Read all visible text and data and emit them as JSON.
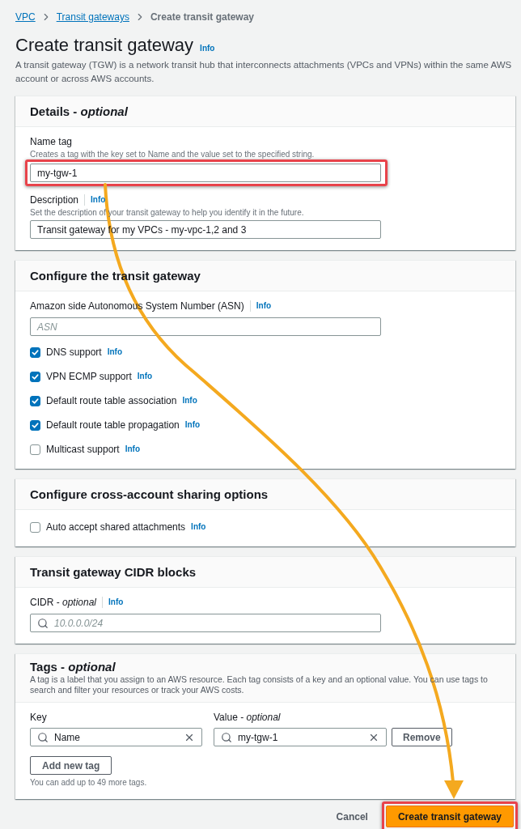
{
  "breadcrumbs": [
    {
      "label": "VPC",
      "kind": "link"
    },
    {
      "label": "Transit gateways",
      "kind": "link"
    },
    {
      "label": "Create transit gateway",
      "kind": "current"
    }
  ],
  "header": {
    "title": "Create transit gateway",
    "info": "Info",
    "description": "A transit gateway (TGW) is a network transit hub that interconnects attachments (VPCs and VPNs) within the same AWS account or across AWS accounts."
  },
  "sections": [
    {
      "title": "Details - *optional*",
      "items": [
        {
          "kind": "input",
          "label": "Name tag",
          "hint": "Creates a tag with the key set to Name and the value set to the specified string.",
          "value": "my-tgw-1",
          "highlighted": true
        },
        {
          "kind": "input",
          "label": "Description",
          "info": "Info",
          "hint": "Set the description of your transit gateway to help you identify it in the future.",
          "value": "Transit gateway for my VPCs - my-vpc-1,2 and 3",
          "highlighted": false
        }
      ]
    },
    {
      "title": "Configure the transit gateway",
      "items": [
        {
          "kind": "input",
          "label": "Amazon side Autonomous System Number (ASN)",
          "info": "Info",
          "placeholder": "ASN",
          "highlighted": false
        },
        {
          "kind": "checkbox",
          "label": "DNS support",
          "info": "Info",
          "checked": true
        },
        {
          "kind": "checkbox",
          "label": "VPN ECMP support",
          "info": "Info",
          "checked": true
        },
        {
          "kind": "checkbox",
          "label": "Default route table association",
          "info": "Info",
          "checked": true
        },
        {
          "kind": "checkbox",
          "label": "Default route table propagation",
          "info": "Info",
          "checked": true
        },
        {
          "kind": "checkbox",
          "label": "Multicast support",
          "info": "Info",
          "checked": false
        }
      ]
    },
    {
      "title": "Configure cross-account sharing options",
      "items": [
        {
          "kind": "checkbox",
          "label": "Auto accept shared attachments",
          "info": "Info",
          "checked": false
        }
      ]
    },
    {
      "title": "Transit gateway CIDR blocks",
      "items": [
        {
          "kind": "search",
          "label": "CIDR - *optional*",
          "info": "Info",
          "placeholder": "10.0.0.0/24",
          "highlighted": false
        }
      ]
    },
    {
      "title": "Tags - *optional*",
      "description": "A tag is a label that you assign to an AWS resource. Each tag consists of a key and an optional value. You can use tags to search and filter your resources or track your AWS costs.",
      "items": [
        {
          "kind": "tags",
          "key_label": "Key",
          "value_label": "Value - *optional*",
          "rows": [
            {
              "key": "Name",
              "value": "my-tgw-1",
              "remove": "Remove"
            }
          ],
          "add": "Add new tag",
          "hint": "You can add up to 49 more tags."
        }
      ]
    }
  ],
  "footer": {
    "cancel": "Cancel",
    "submit": "Create transit gateway",
    "highlighted": true
  }
}
